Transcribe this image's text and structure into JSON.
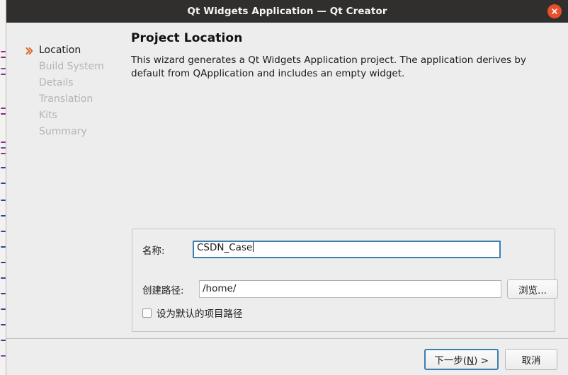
{
  "window": {
    "title": "Qt Widgets Application — Qt Creator",
    "close_icon": "close-icon",
    "titlebar_color": "#302f2d",
    "close_button_color": "#e8502a"
  },
  "sidebar": {
    "active_marker_icon": "chevron-double-right-icon",
    "accent_color": "#e06a28",
    "items": [
      {
        "label": "Location",
        "active": true
      },
      {
        "label": "Build System",
        "active": false
      },
      {
        "label": "Details",
        "active": false
      },
      {
        "label": "Translation",
        "active": false
      },
      {
        "label": "Kits",
        "active": false
      },
      {
        "label": "Summary",
        "active": false
      }
    ]
  },
  "content": {
    "title": "Project Location",
    "description": "This wizard generates a Qt Widgets Application project. The application derives by default from QApplication and includes an empty widget."
  },
  "form": {
    "name_label": "名称:",
    "name_value": "CSDN_Case",
    "path_label": "创建路径:",
    "path_value": "/home/",
    "browse_label": "浏览...",
    "checkbox_label": "设为默认的项目路径",
    "checkbox_checked": false,
    "focus_color": "#3c7fb1"
  },
  "footer": {
    "next_prefix": "下一步(",
    "next_mnemonic": "N",
    "next_suffix": ") >",
    "cancel_label": "取消"
  }
}
